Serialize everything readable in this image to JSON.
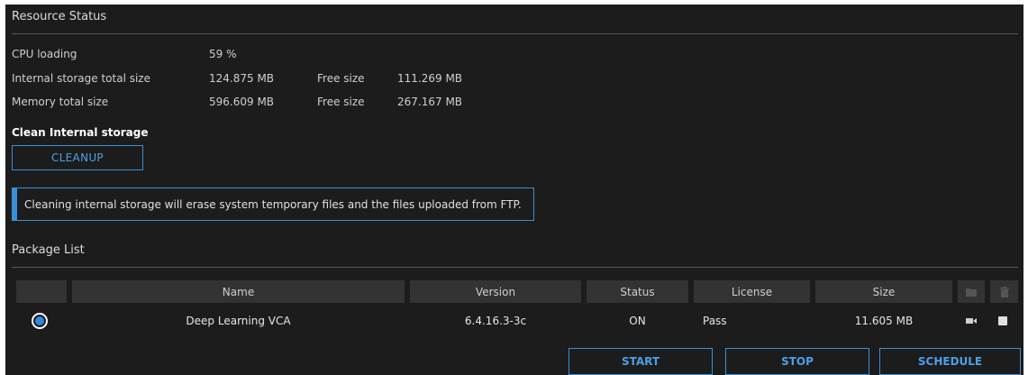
{
  "resource_status": {
    "title": "Resource Status",
    "cpu_label": "CPU loading",
    "cpu_value": "59 %",
    "storage_label": "Internal storage total size",
    "storage_total": "124.875 MB",
    "storage_free_label": "Free size",
    "storage_free": "111.269 MB",
    "memory_label": "Memory total size",
    "memory_total": "596.609 MB",
    "memory_free_label": "Free size",
    "memory_free": "267.167 MB"
  },
  "clean": {
    "title": "Clean Internal storage",
    "button_label": "CLEANUP",
    "notice": "Cleaning internal storage will erase system temporary files and the files uploaded from FTP."
  },
  "package_list": {
    "title": "Package List",
    "columns": [
      "Name",
      "Version",
      "Status",
      "License",
      "Size"
    ],
    "header_icons": [
      "folder-icon",
      "trash-icon"
    ],
    "rows": [
      {
        "selected": true,
        "name": "Deep Learning VCA",
        "version": "6.4.16.3-3c",
        "status": "ON",
        "license": "Pass",
        "size": "11.605 MB",
        "icons": [
          "video-camera-icon",
          "checkbox"
        ]
      }
    ],
    "buttons": {
      "start": "START",
      "stop": "STOP",
      "schedule": "SCHEDULE"
    }
  },
  "colors": {
    "accent": "#3a8fd6",
    "background": "#1c1c1c",
    "header": "#333333"
  }
}
